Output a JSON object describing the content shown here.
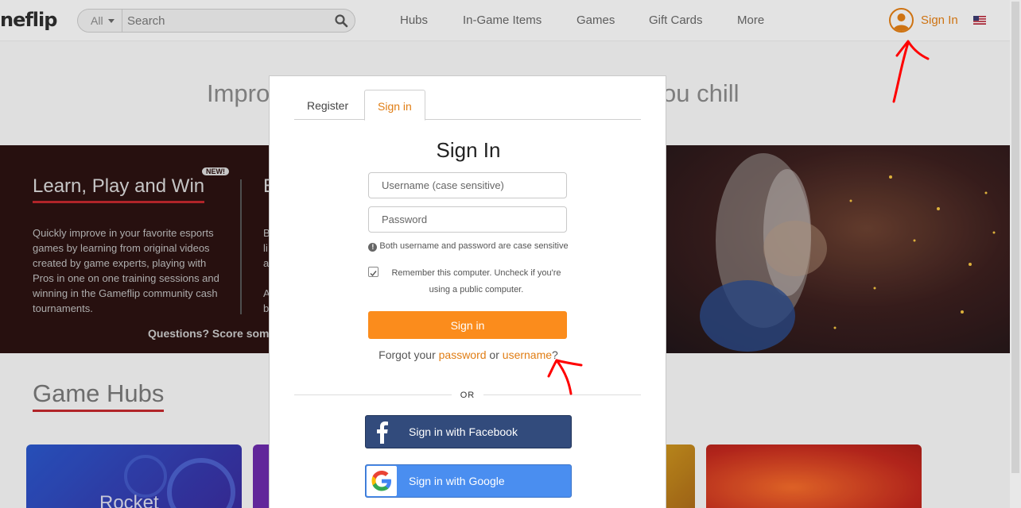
{
  "header": {
    "logo": "neflip",
    "search": {
      "category": "All",
      "placeholder": "Search"
    },
    "nav": [
      "Hubs",
      "In-Game Items",
      "Games",
      "Gift Cards",
      "More"
    ],
    "sign_in": "Sign In"
  },
  "hero": {
    "title_left": "Impro",
    "title_right": "ou chill"
  },
  "banner": {
    "title": "Learn, Play and Win",
    "badge": "NEW!",
    "description": "Quickly improve in your favorite esports games by learning from original videos created by game experts, playing with Pros in one on one training sessions and winning in the Gameflip community cash tournaments.",
    "second_title": "E",
    "second_desc_lines": [
      "B",
      "li",
      "a",
      "",
      "A",
      "b"
    ],
    "questions": "Questions? Score som"
  },
  "hubs": {
    "title": "Game Hubs",
    "card_label": "Rocket"
  },
  "modal": {
    "tabs": [
      "Register",
      "Sign in"
    ],
    "title": "Sign In",
    "username_placeholder": "Username (case sensitive)",
    "password_placeholder": "Password",
    "hint": "Both username and password are case sensitive",
    "remember": "Remember this computer. Uncheck if you're using a public computer.",
    "remember_checked": true,
    "submit": "Sign in",
    "forgot_prefix": "Forgot your ",
    "forgot_password": "password",
    "forgot_or": " or ",
    "forgot_username": "username",
    "forgot_suffix": "?",
    "or": "OR",
    "facebook": "Sign in with Facebook",
    "google": "Sign in with Google"
  },
  "colors": {
    "accent": "#fb8c1c",
    "link": "#e07d14",
    "banner_red": "#c0282d",
    "facebook": "#324b7c",
    "google": "#4a8ef0",
    "annotation": "#ff0000"
  }
}
